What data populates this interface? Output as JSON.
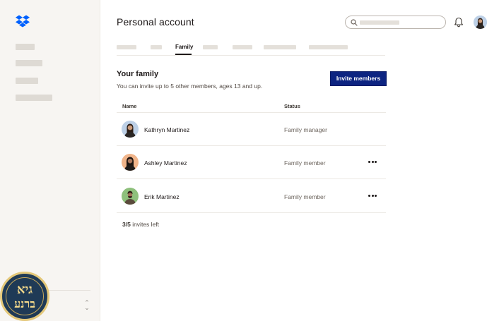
{
  "header": {
    "title": "Personal account"
  },
  "tabs": {
    "active_label": "Family"
  },
  "family": {
    "title": "Your family",
    "subtitle": "You can invite up to 5 other members, ages 13 and up.",
    "invite_button": "Invite members",
    "columns": {
      "name": "Name",
      "status": "Status"
    },
    "members": [
      {
        "name": "Kathryn Martinez",
        "status": "Family manager",
        "has_menu": false
      },
      {
        "name": "Ashley Martinez",
        "status": "Family member",
        "has_menu": true
      },
      {
        "name": "Erik Martinez",
        "status": "Family member",
        "has_menu": true
      }
    ],
    "invites_used": "3/5",
    "invites_suffix": " invites left"
  },
  "badge": {
    "line1": "גיא",
    "line2": "ברנע"
  },
  "icons": {
    "logo": "dropbox-logo-icon",
    "search": "search-icon",
    "notifications": "bell-icon",
    "more": "more-horizontal-icon",
    "sidebar_toggle": "chevron-up-down-icon"
  },
  "colors": {
    "brand": "#0061fe",
    "primary_button": "#0d2481",
    "sidebar_bg": "#f7f5f2",
    "placeholder": "#e4e0da"
  }
}
